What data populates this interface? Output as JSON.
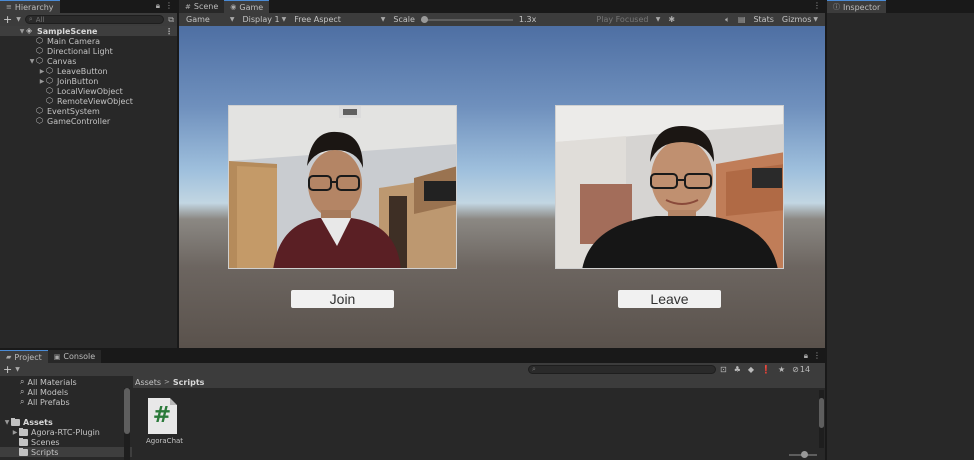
{
  "hierarchy": {
    "tab_label": "Hierarchy",
    "search_placeholder": "All",
    "add_label": "+",
    "items": [
      {
        "label": "SampleScene",
        "indent": 0,
        "arrow": "▼",
        "icon": "unity-scene-icon"
      },
      {
        "label": "Main Camera",
        "indent": 1,
        "arrow": "",
        "icon": "gameobject-icon"
      },
      {
        "label": "Directional Light",
        "indent": 1,
        "arrow": "",
        "icon": "gameobject-icon"
      },
      {
        "label": "Canvas",
        "indent": 1,
        "arrow": "▼",
        "icon": "gameobject-icon"
      },
      {
        "label": "LeaveButton",
        "indent": 2,
        "arrow": "▶",
        "icon": "gameobject-icon"
      },
      {
        "label": "JoinButton",
        "indent": 2,
        "arrow": "▶",
        "icon": "gameobject-icon"
      },
      {
        "label": "LocalViewObject",
        "indent": 2,
        "arrow": "",
        "icon": "gameobject-icon"
      },
      {
        "label": "RemoteViewObject",
        "indent": 2,
        "arrow": "",
        "icon": "gameobject-icon"
      },
      {
        "label": "EventSystem",
        "indent": 1,
        "arrow": "",
        "icon": "gameobject-icon"
      },
      {
        "label": "GameController",
        "indent": 1,
        "arrow": "",
        "icon": "gameobject-icon"
      }
    ]
  },
  "game_view": {
    "tabs": [
      {
        "label": "Scene",
        "icon": "scene-icon",
        "active": false
      },
      {
        "label": "Game",
        "icon": "game-icon",
        "active": true
      }
    ],
    "toolbar": {
      "mode": "Game",
      "display": "Display 1",
      "aspect": "Free Aspect",
      "scale_label": "Scale",
      "scale_value": "1.3x",
      "play_focused": "Play Focused",
      "stats": "Stats",
      "gizmos": "Gizmos"
    },
    "join_button_label": "Join",
    "leave_button_label": "Leave"
  },
  "inspector": {
    "tab_label": "Inspector"
  },
  "project": {
    "tabs": [
      {
        "label": "Project",
        "icon": "folder-icon",
        "active": true
      },
      {
        "label": "Console",
        "icon": "console-icon",
        "active": false
      }
    ],
    "add_label": "+",
    "hidden_count": "14",
    "favorites": [
      "All Materials",
      "All Models",
      "All Prefabs"
    ],
    "assets_root": "Assets",
    "folders": [
      "Agora-RTC-Plugin",
      "Scenes",
      "Scripts"
    ],
    "breadcrumb": [
      "Assets",
      "Scripts"
    ],
    "files": [
      {
        "name": "AgoraChat",
        "icon": "csharp-script-icon"
      }
    ]
  },
  "colors": {
    "accent": "#4a8bd6",
    "panel": "#282828",
    "toolbar": "#3c3c3c",
    "background": "#191919"
  }
}
